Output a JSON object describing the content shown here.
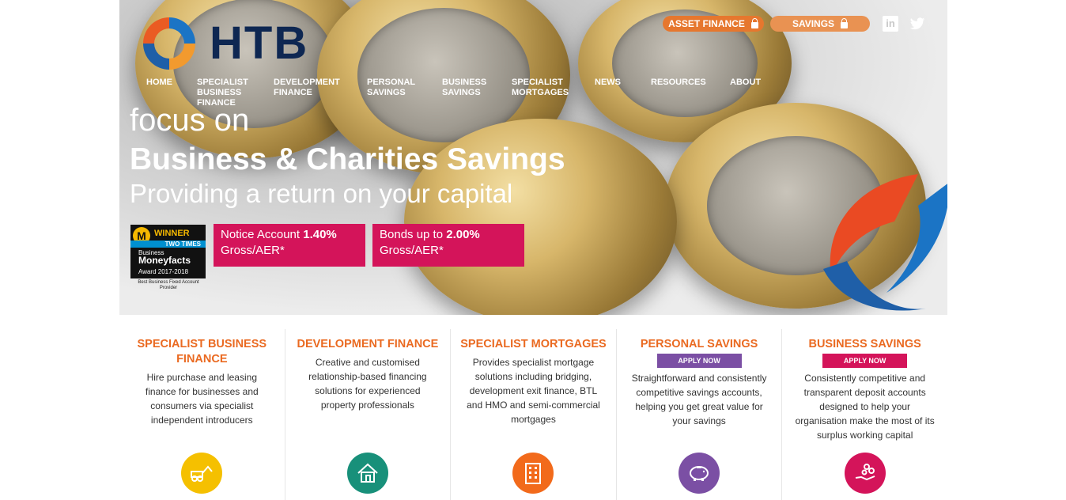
{
  "colors": {
    "orange": "#ea6a21",
    "navy": "#0e2752",
    "pink": "#d4145a",
    "purple": "#7b4fa4",
    "teal": "#18907a",
    "yellow": "#f5c000"
  },
  "logo": {
    "text": "HTB"
  },
  "top_links": {
    "asset_finance": "ASSET FINANCE",
    "savings": "SAVINGS",
    "linkedin": "in"
  },
  "nav": [
    {
      "label": "HOME"
    },
    {
      "label": "SPECIALIST\nBUSINESS\nFINANCE"
    },
    {
      "label": "DEVELOPMENT\nFINANCE"
    },
    {
      "label": "PERSONAL\nSAVINGS"
    },
    {
      "label": "BUSINESS\nSAVINGS"
    },
    {
      "label": "SPECIALIST\nMORTGAGES"
    },
    {
      "label": "NEWS"
    },
    {
      "label": "RESOURCES"
    },
    {
      "label": "ABOUT"
    }
  ],
  "hero": {
    "line1": "focus on",
    "line2": "Business & Charities Savings",
    "line3": "Providing a return on your capital"
  },
  "award": {
    "m": "M",
    "winner": "WINNER",
    "two_times": "TWO TIMES",
    "business": "Business",
    "moneyfacts": "Moneyfacts",
    "years": "Award 2017-2018",
    "caption": "Best Business Fixed Account Provider"
  },
  "rates": [
    {
      "label": "Notice Account",
      "rate": "1.40%",
      "suffix": "Gross/AER*"
    },
    {
      "label": "Bonds up to",
      "rate": "2.00%",
      "suffix": "Gross/AER*"
    }
  ],
  "columns": [
    {
      "title": "SPECIALIST BUSINESS FINANCE",
      "desc": "Hire purchase and leasing finance for businesses and consumers via specialist independent introducers",
      "icon": "digger-icon"
    },
    {
      "title": "DEVELOPMENT FINANCE",
      "desc": "Creative and customised relationship-based financing solutions for experienced property professionals",
      "icon": "house-icon"
    },
    {
      "title": "SPECIALIST MORTGAGES",
      "desc": "Provides specialist mortgage solutions including bridging, development exit finance, BTL and HMO and semi-commercial mortgages",
      "icon": "building-icon"
    },
    {
      "title": "PERSONAL SAVINGS",
      "apply": "APPLY NOW",
      "desc": "Straightforward and consistently competitive savings accounts, helping you get great value for your savings",
      "icon": "piggy-bank-icon"
    },
    {
      "title": "BUSINESS SAVINGS",
      "apply": "APPLY NOW",
      "desc": "Consistently competitive and transparent deposit accounts designed to help your organisation make the most of its surplus working capital",
      "icon": "coins-hand-icon"
    }
  ]
}
